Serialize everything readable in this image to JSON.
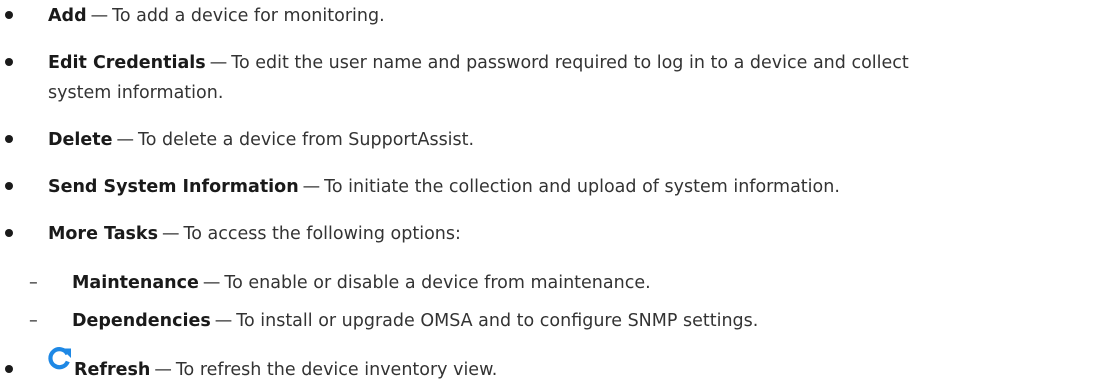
{
  "items": [
    {
      "term": "Add",
      "sep": "—",
      "desc": "To add a device for monitoring."
    },
    {
      "term": "Edit Credentials",
      "sep": "—",
      "desc": "To edit the user name and password required to log in to a device and collect",
      "cont": "system information."
    },
    {
      "term": "Delete",
      "sep": "—",
      "desc": "To delete a device from SupportAssist."
    },
    {
      "term": "Send System Information",
      "sep": "—",
      "desc": "To initiate the collection and upload of system information."
    },
    {
      "term": "More Tasks",
      "sep": "—",
      "desc": "To access the following options:"
    }
  ],
  "subitems": [
    {
      "dash": "–",
      "term": "Maintenance",
      "sep": "—",
      "desc": "To enable or disable a device from maintenance."
    },
    {
      "dash": "–",
      "term": "Dependencies",
      "sep": "—",
      "desc": "To install or upgrade OMSA and to configure SNMP settings."
    }
  ],
  "refresh": {
    "icon": "refresh-icon",
    "term": "Refresh",
    "sep": "—",
    "desc": "To refresh the device inventory view."
  },
  "colors": {
    "icon": "#1e88e5",
    "text": "#333333",
    "term": "#1a1a1a"
  }
}
